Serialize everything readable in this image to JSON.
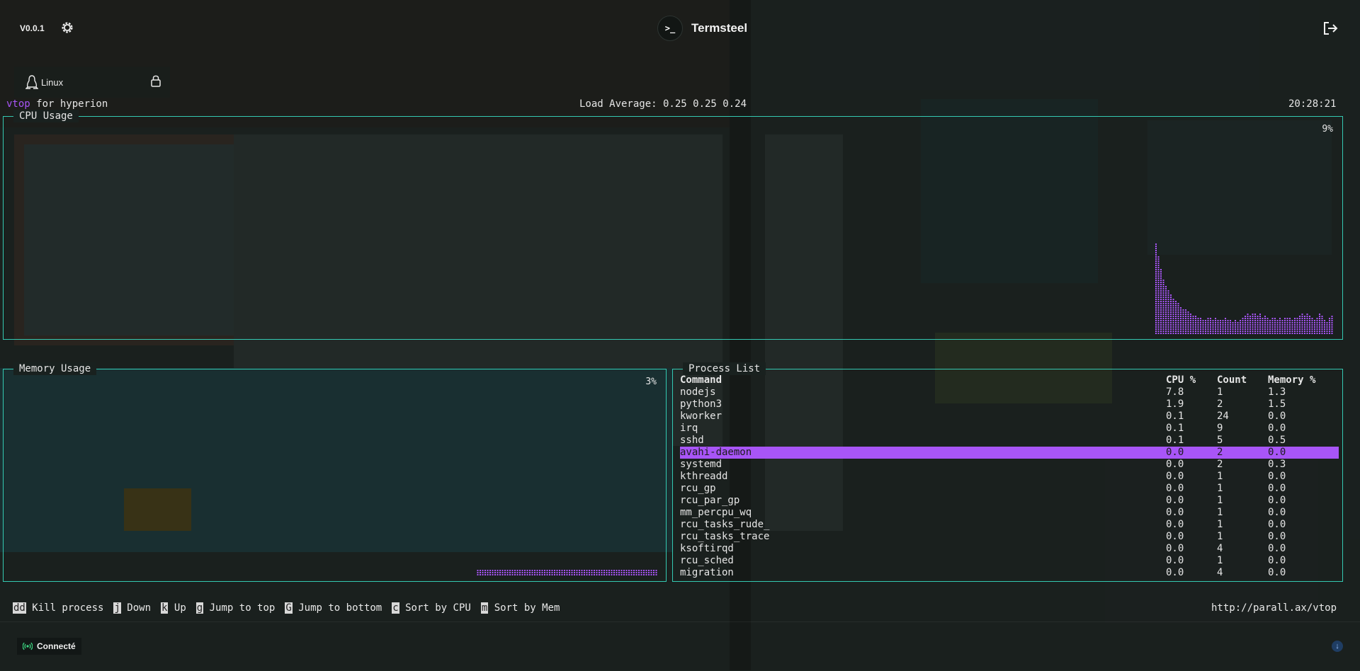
{
  "app": {
    "version": "V0.0.1",
    "brand_name": "Termsteel",
    "brand_glyph": ">_",
    "icons": {
      "settings": "gear-icon",
      "logout": "logout-icon",
      "os": "penguin-icon",
      "lock": "lock-icon",
      "status": "signal-icon",
      "scroll": "arrow-down-icon"
    }
  },
  "tab": {
    "label": "Linux"
  },
  "vtop": {
    "name": "vtop",
    "host_text": " for hyperion",
    "load_average": "Load Average: 0.25 0.25 0.24",
    "time": "20:28:21",
    "accent": "#a855f7",
    "border_color": "#34c9b2"
  },
  "cpu_panel": {
    "title": "CPU Usage",
    "percent": "9%"
  },
  "memory_panel": {
    "title": "Memory Usage",
    "percent": "3%"
  },
  "chart_data": [
    {
      "type": "bar",
      "title": "CPU Usage",
      "ylim": [
        0,
        100
      ],
      "values": [
        42,
        36,
        30,
        26,
        23,
        21,
        19,
        17,
        16,
        15,
        13,
        12,
        12,
        11,
        10,
        9,
        9,
        8,
        8,
        7,
        7,
        8,
        8,
        7,
        8,
        7,
        7,
        7,
        8,
        7,
        7,
        6,
        7,
        6,
        7,
        8,
        9,
        10,
        9,
        10,
        10,
        9,
        10,
        8,
        9,
        8,
        7,
        8,
        8,
        7,
        8,
        7,
        8,
        8,
        8,
        7,
        8,
        8,
        9,
        10,
        9,
        10,
        9,
        8,
        7,
        8,
        10,
        9,
        7,
        6,
        8,
        9
      ]
    },
    {
      "type": "bar",
      "title": "Memory Usage",
      "ylim": [
        0,
        100
      ],
      "values": [
        3,
        3,
        3,
        3,
        3,
        3,
        3,
        3,
        3,
        3,
        3,
        3,
        3,
        3,
        3,
        3,
        3,
        3,
        3,
        3,
        3,
        3,
        3,
        3,
        3,
        3,
        3,
        3,
        3,
        3,
        3,
        3,
        3,
        3,
        3,
        3,
        3,
        3,
        3,
        3,
        3,
        3,
        3,
        3,
        3,
        3,
        3,
        3,
        3,
        3,
        3,
        3,
        3,
        3,
        3,
        3,
        3,
        3,
        3,
        3,
        3,
        3,
        3,
        3,
        3,
        3,
        3,
        3,
        3,
        3,
        3,
        3,
        3
      ]
    }
  ],
  "process_panel": {
    "title": "Process List",
    "columns": [
      "Command",
      "CPU %",
      "Count",
      "Memory %"
    ],
    "selected_index": 5,
    "rows": [
      [
        "nodejs",
        "7.8",
        "1",
        "1.3"
      ],
      [
        "python3",
        "1.9",
        "2",
        "1.5"
      ],
      [
        "kworker",
        "0.1",
        "24",
        "0.0"
      ],
      [
        "irq",
        "0.1",
        "9",
        "0.0"
      ],
      [
        "sshd",
        "0.1",
        "5",
        "0.5"
      ],
      [
        "avahi-daemon",
        "0.0",
        "2",
        "0.0"
      ],
      [
        "systemd",
        "0.0",
        "2",
        "0.3"
      ],
      [
        "kthreadd",
        "0.0",
        "1",
        "0.0"
      ],
      [
        "rcu_gp",
        "0.0",
        "1",
        "0.0"
      ],
      [
        "rcu_par_gp",
        "0.0",
        "1",
        "0.0"
      ],
      [
        "mm_percpu_wq",
        "0.0",
        "1",
        "0.0"
      ],
      [
        "rcu_tasks_rude_",
        "0.0",
        "1",
        "0.0"
      ],
      [
        "rcu_tasks_trace",
        "0.0",
        "1",
        "0.0"
      ],
      [
        "ksoftirqd",
        "0.0",
        "4",
        "0.0"
      ],
      [
        "rcu_sched",
        "0.0",
        "1",
        "0.0"
      ],
      [
        "migration",
        "0.0",
        "4",
        "0.0"
      ]
    ]
  },
  "help": [
    {
      "key": "dd",
      "label": " Kill process"
    },
    {
      "key": "j",
      "label": " Down"
    },
    {
      "key": "k",
      "label": " Up"
    },
    {
      "key": "g",
      "label": " Jump to top"
    },
    {
      "key": "G",
      "label": " Jump to bottom"
    },
    {
      "key": "c",
      "label": " Sort by CPU"
    },
    {
      "key": "m",
      "label": " Sort by Mem"
    }
  ],
  "url": "http://parall.ax/vtop",
  "status": {
    "label": "Connecté",
    "color": "#3ddc84"
  }
}
